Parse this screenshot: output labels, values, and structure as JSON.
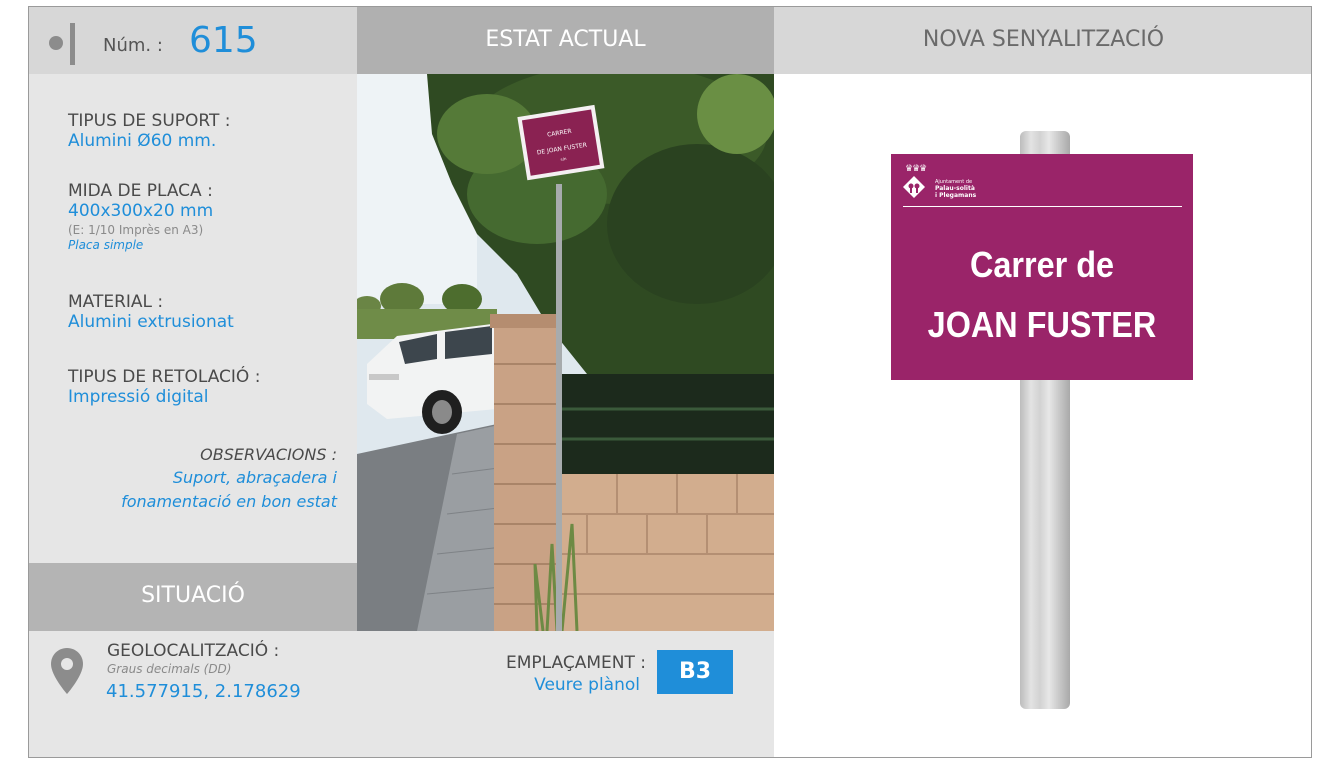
{
  "header": {
    "num_label": "Núm. :",
    "num_value": "615",
    "estat_title": "ESTAT ACTUAL",
    "nova_title": "NOVA SENYALITZACIÓ"
  },
  "specs": {
    "tipus_suport_label": "TIPUS DE SUPORT :",
    "tipus_suport_value": "Alumini Ø60 mm.",
    "mida_placa_label": "MIDA DE PLACA :",
    "mida_placa_value": "400x300x20 mm",
    "mida_placa_note": "(E: 1/10 Imprès en A3)",
    "mida_placa_type": "Placa simple",
    "material_label": "MATERIAL :",
    "material_value": "Alumini extrusionat",
    "retolacio_label": "TIPUS DE RETOLACIÓ :",
    "retolacio_value": "Impressió digital",
    "observacions_label": "OBSERVACIONS :",
    "observacions_line1": "Suport, abraçadera i",
    "observacions_line2": "fonamentació en bon estat"
  },
  "situacio": {
    "title": "SITUACIÓ",
    "geo_label": "GEOLOCALITZACIÓ :",
    "geo_note": "Graus decimals (DD)",
    "geo_value": "41.577915, 2.178629",
    "empl_label": "EMPLAÇAMENT :",
    "empl_value": "Veure plànol",
    "empl_badge": "B3"
  },
  "photo": {
    "sign_line1": "CARRER",
    "sign_line2": "DE JOAN FUSTER",
    "sign_line3": "s/n"
  },
  "new_sign": {
    "logo_small": "Ajuntament de",
    "logo_name_line1": "Palau-solità",
    "logo_name_line2": "i Plegamans",
    "line1": "Carrer de",
    "line2": "JOAN FUSTER",
    "color": "#9a2469"
  },
  "colors": {
    "accent": "#1f8ed9",
    "header_gray": "#d7d7d7",
    "estat_header": "#b0b0b0",
    "panel": "#e6e6e6"
  }
}
